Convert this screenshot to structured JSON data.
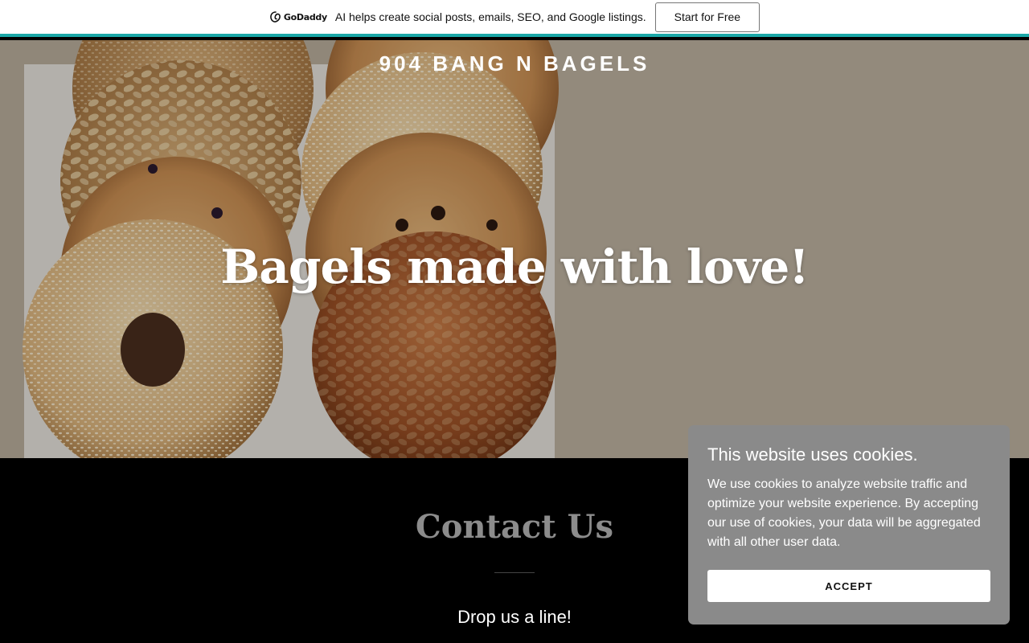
{
  "promo": {
    "logo_text": "GoDaddy",
    "message": "AI helps create social posts, emails, SEO, and Google listings.",
    "cta_label": "Start for Free",
    "accent_color": "#1ba8a8"
  },
  "hero": {
    "site_title": "904 BANG N BAGELS",
    "heading": "Bagels made with love!",
    "image": "bagels-photo"
  },
  "contact": {
    "title": "Contact Us",
    "subtitle": "Drop us a line!"
  },
  "cookie_banner": {
    "title": "This website uses cookies.",
    "body": "We use cookies to analyze website traffic and optimize your website experience. By accepting our use of cookies, your data will be aggregated with all other user data.",
    "accept_label": "ACCEPT"
  }
}
